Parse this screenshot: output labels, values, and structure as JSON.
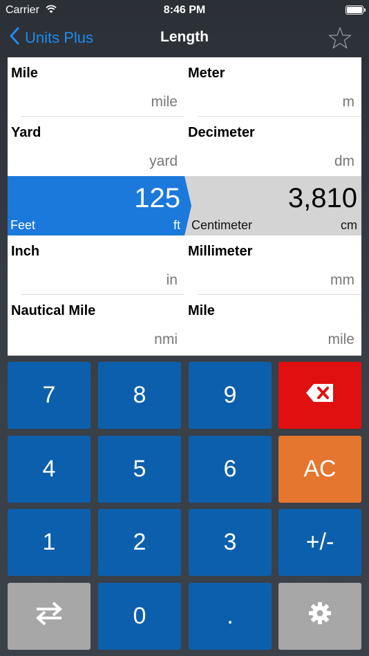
{
  "status_bar": {
    "carrier": "Carrier",
    "time": "8:46 PM"
  },
  "nav": {
    "back_label": "Units Plus",
    "title": "Length"
  },
  "units": [
    {
      "name": "Mile",
      "abbr": "mile"
    },
    {
      "name": "Meter",
      "abbr": "m"
    },
    {
      "name": "Yard",
      "abbr": "yard"
    },
    {
      "name": "Decimeter",
      "abbr": "dm"
    },
    {
      "name": "Inch",
      "abbr": "in"
    },
    {
      "name": "Millimeter",
      "abbr": "mm"
    },
    {
      "name": "Nautical Mile",
      "abbr": "nmi"
    },
    {
      "name": "Mile",
      "abbr": "mile"
    }
  ],
  "conversion": {
    "from": {
      "value": "125",
      "name": "Feet",
      "abbr": "ft"
    },
    "to": {
      "value": "3,810",
      "name": "Centimeter",
      "abbr": "cm"
    }
  },
  "keypad": {
    "k7": "7",
    "k8": "8",
    "k9": "9",
    "k4": "4",
    "k5": "5",
    "k6": "6",
    "ac": "AC",
    "k1": "1",
    "k2": "2",
    "k3": "3",
    "sign": "+/-",
    "k0": "0",
    "dot": "."
  },
  "icons": {
    "back": "chevron-left-icon",
    "favorite": "star-icon",
    "delete": "backspace-icon",
    "swap": "swap-arrows-icon",
    "settings": "gear-icon"
  },
  "colors": {
    "accent": "#1e8cf0",
    "active_from": "#1b79db",
    "active_to": "#d4d4d4",
    "key": "#0c5fad",
    "delete_key": "#e01010",
    "clear_key": "#e4762f",
    "utility_key": "#a7a7a7"
  }
}
